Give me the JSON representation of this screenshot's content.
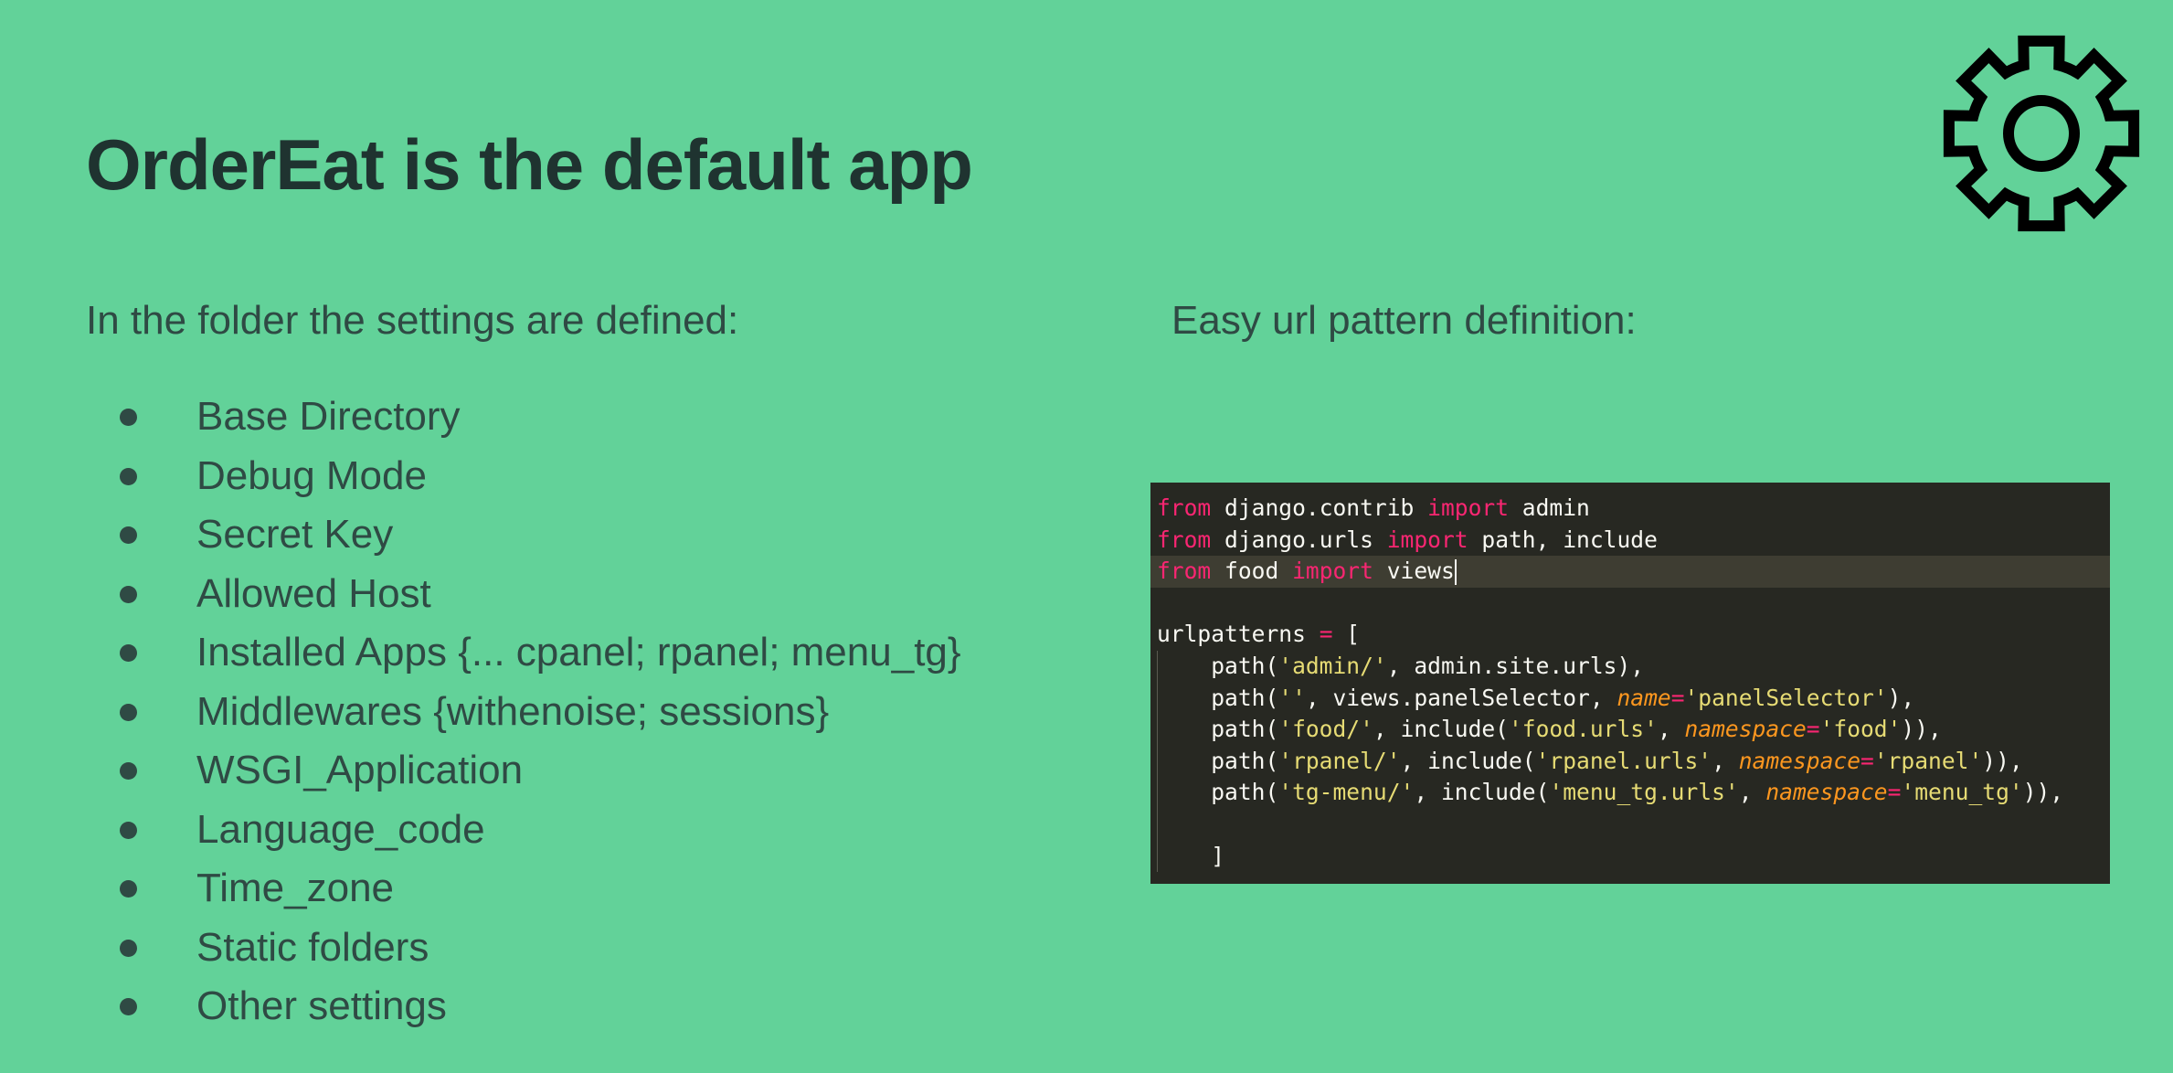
{
  "slide": {
    "title": "OrderEat is the default app",
    "icon": "gear-icon"
  },
  "left": {
    "intro": "In the folder the settings are defined:",
    "items": [
      "Base Directory",
      "Debug Mode",
      "Secret Key",
      "Allowed Host",
      "Installed Apps {... cpanel; rpanel; menu_tg}",
      "Middlewares {withenoise; sessions}",
      "WSGI_Application",
      "Language_code",
      "Time_zone",
      "Static folders",
      "Other settings"
    ]
  },
  "right": {
    "intro": "Easy url pattern definition:"
  },
  "code": {
    "lines": [
      [
        {
          "t": "from",
          "c": "kw"
        },
        {
          "t": " django.contrib "
        },
        {
          "t": "import",
          "c": "kw"
        },
        {
          "t": " admin"
        }
      ],
      [
        {
          "t": "from",
          "c": "kw"
        },
        {
          "t": " django.urls "
        },
        {
          "t": "import",
          "c": "kw"
        },
        {
          "t": " path, include"
        }
      ],
      [
        {
          "t": "from",
          "c": "kw"
        },
        {
          "t": " food "
        },
        {
          "t": "import",
          "c": "kw"
        },
        {
          "t": " views"
        }
      ],
      [],
      [
        {
          "t": "urlpatterns "
        },
        {
          "t": "=",
          "c": "kw"
        },
        {
          "t": " ["
        }
      ],
      [
        {
          "t": "    path("
        },
        {
          "t": "'admin/'",
          "c": "str"
        },
        {
          "t": ", admin.site.urls),"
        }
      ],
      [
        {
          "t": "    path("
        },
        {
          "t": "''",
          "c": "str"
        },
        {
          "t": ", views.panelSelector, "
        },
        {
          "t": "name",
          "c": "arg"
        },
        {
          "t": "=",
          "c": "kw"
        },
        {
          "t": "'panelSelector'",
          "c": "str"
        },
        {
          "t": "),"
        }
      ],
      [
        {
          "t": "    path("
        },
        {
          "t": "'food/'",
          "c": "str"
        },
        {
          "t": ", include("
        },
        {
          "t": "'food.urls'",
          "c": "str"
        },
        {
          "t": ", "
        },
        {
          "t": "namespace",
          "c": "arg"
        },
        {
          "t": "=",
          "c": "kw"
        },
        {
          "t": "'food'",
          "c": "str"
        },
        {
          "t": ")),"
        }
      ],
      [
        {
          "t": "    path("
        },
        {
          "t": "'rpanel/'",
          "c": "str"
        },
        {
          "t": ", include("
        },
        {
          "t": "'rpanel.urls'",
          "c": "str"
        },
        {
          "t": ", "
        },
        {
          "t": "namespace",
          "c": "arg"
        },
        {
          "t": "=",
          "c": "kw"
        },
        {
          "t": "'rpanel'",
          "c": "str"
        },
        {
          "t": ")),"
        }
      ],
      [
        {
          "t": "    path("
        },
        {
          "t": "'tg-menu/'",
          "c": "str"
        },
        {
          "t": ", include("
        },
        {
          "t": "'menu_tg.urls'",
          "c": "str"
        },
        {
          "t": ", "
        },
        {
          "t": "namespace",
          "c": "arg"
        },
        {
          "t": "=",
          "c": "kw"
        },
        {
          "t": "'menu_tg'",
          "c": "str"
        },
        {
          "t": ")),"
        }
      ],
      [],
      [
        {
          "t": "    ]"
        }
      ]
    ],
    "current_line": 2,
    "colors": {
      "background": "#272822",
      "keyword": "#f92672",
      "string": "#e6db74",
      "argument": "#fd971f",
      "text": "#f8f8f2"
    }
  },
  "colors": {
    "background": "#62d299",
    "title": "#1f3330",
    "body_text": "#2f4a44"
  }
}
